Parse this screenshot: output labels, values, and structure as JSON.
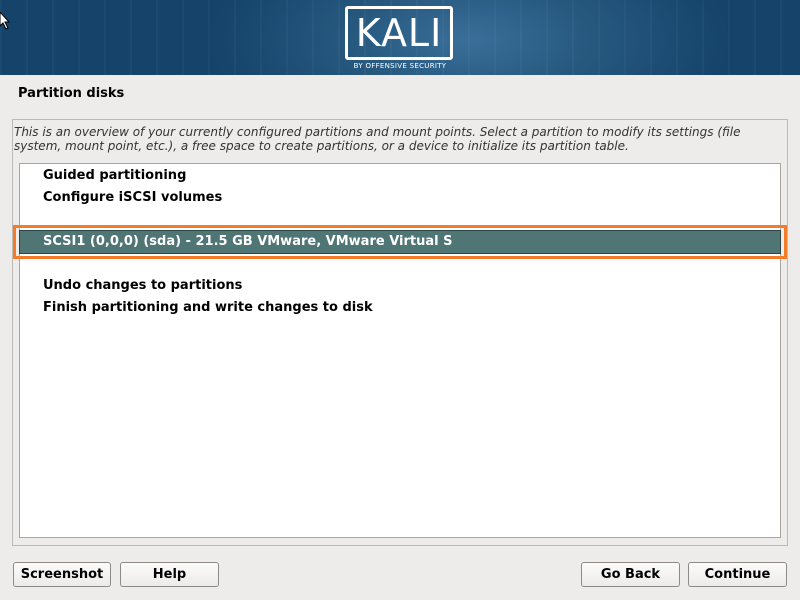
{
  "banner": {
    "logo_text": "KALI",
    "logo_subtext": "BY OFFENSIVE SECURITY"
  },
  "page": {
    "title": "Partition disks",
    "description": "This is an overview of your currently configured partitions and mount points. Select a partition to modify its settings (file system, mount point, etc.), a free space to create partitions, or a device to initialize its partition table."
  },
  "list": {
    "guided": "Guided partitioning",
    "iscsi": "Configure iSCSI volumes",
    "disk": "SCSI1 (0,0,0) (sda) - 21.5 GB VMware, VMware Virtual S",
    "undo": "Undo changes to partitions",
    "finish": "Finish partitioning and write changes to disk",
    "selected_index": 2
  },
  "buttons": {
    "screenshot": "Screenshot",
    "help": "Help",
    "go_back": "Go Back",
    "continue": "Continue"
  },
  "colors": {
    "banner": "#27597f",
    "selection": "#4f7574",
    "highlight_outline": "#f47c28",
    "background": "#edeceb"
  },
  "icons": [
    "cursor-icon"
  ]
}
